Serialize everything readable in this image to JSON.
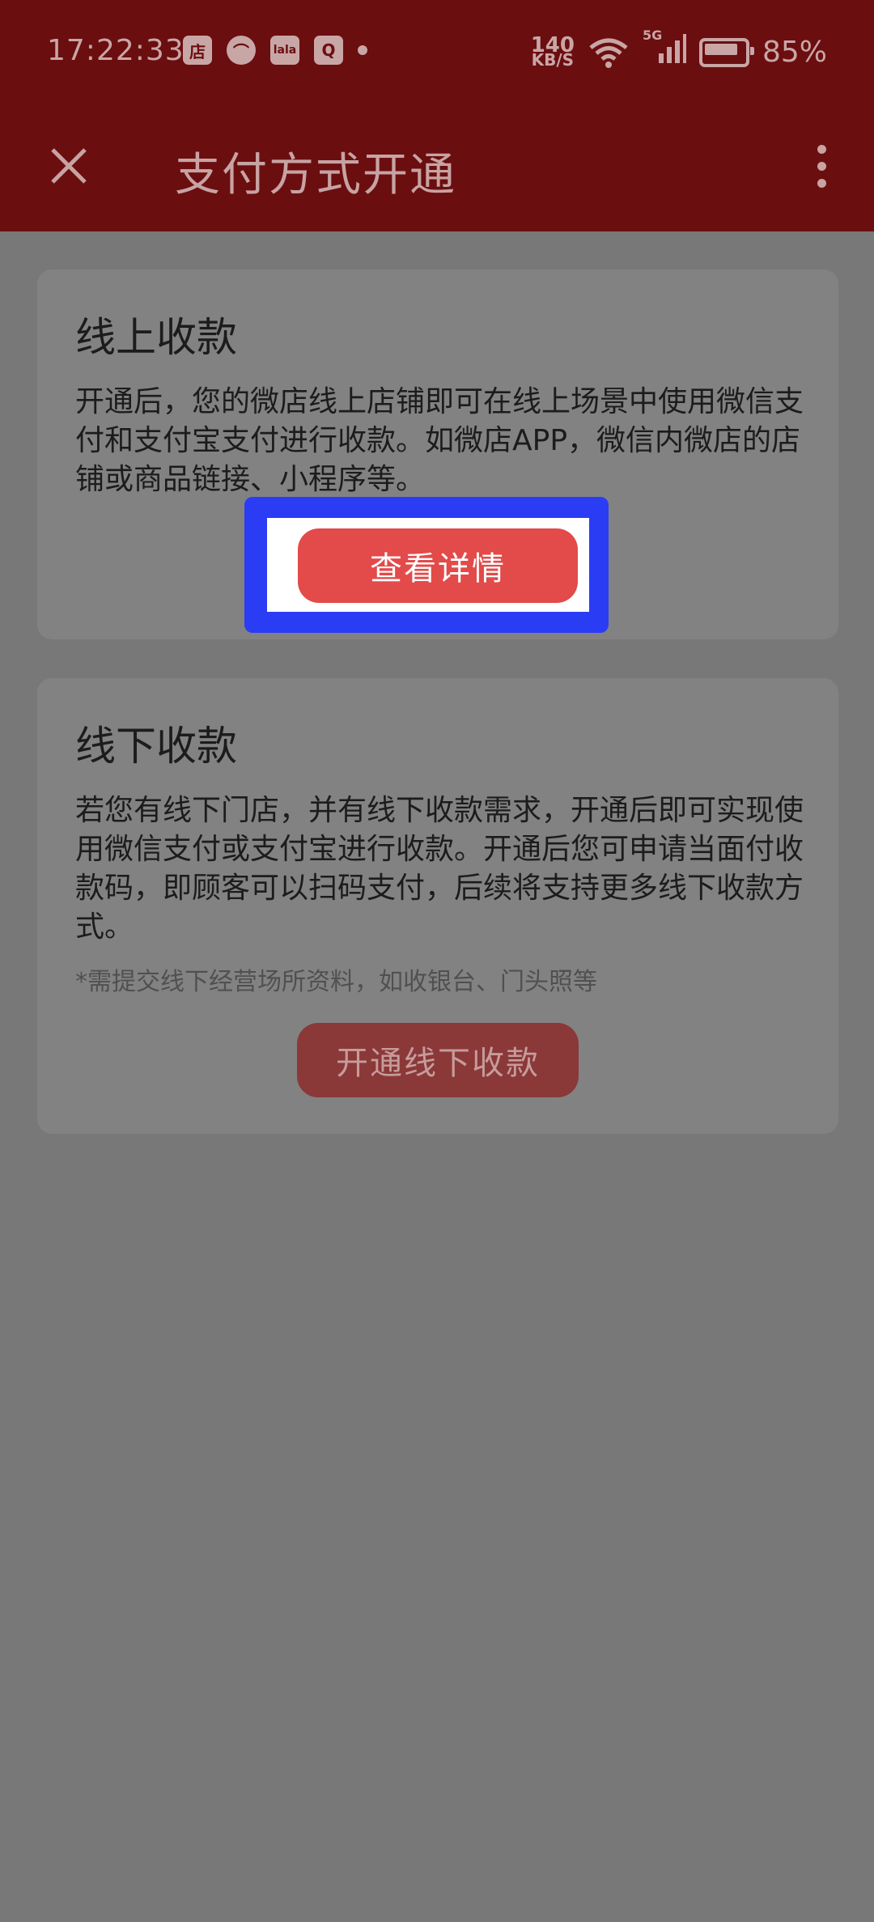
{
  "status_bar": {
    "time": "17:22:33",
    "app_icons": [
      "店",
      "⌒",
      "lala",
      "Q"
    ],
    "network_speed_value": "140",
    "network_speed_unit": "KB/S",
    "signal_label": "5G",
    "battery_percent": "85%"
  },
  "app_bar": {
    "title": "支付方式开通"
  },
  "online": {
    "title": "线上收款",
    "description": "开通后，您的微店线上店铺即可在线上场景中使用微信支付和支付宝支付进行收款。如微店APP，微信内微店的店铺或商品链接、小程序等。",
    "button_label": "查看详情"
  },
  "offline": {
    "title": "线下收款",
    "description": "若您有线下门店，并有线下收款需求，开通后即可实现使用微信支付或支付宝进行收款。开通后您可申请当面付收款码，即顾客可以扫码支付，后续将支持更多线下收款方式。",
    "note": "*需提交线下经营场所资料，如收银台、门头照等",
    "button_label": "开通线下收款"
  },
  "colors": {
    "header": "#6b0e10",
    "overlay": "#787878",
    "primary_button": "#e34a4a",
    "highlight_border": "#2b3cf5"
  }
}
